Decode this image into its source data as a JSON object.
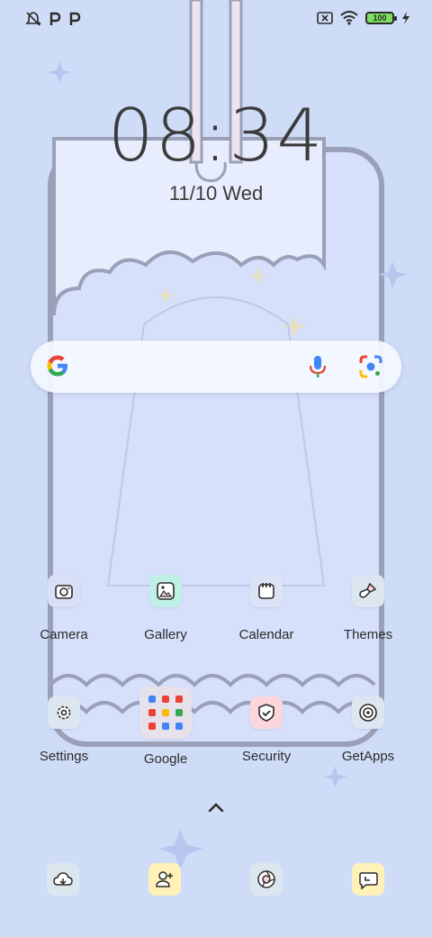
{
  "status_bar": {
    "left_icons": [
      "notifications-off-icon",
      "p-app-icon",
      "p-app-icon"
    ],
    "right_icons": [
      "sim-error-icon",
      "wifi-icon",
      "battery-icon",
      "charging-icon"
    ],
    "battery_level": "100"
  },
  "clock": {
    "time": "08:34",
    "date": "11/10 Wed"
  },
  "search": {
    "logo": "google-g-icon",
    "voice_icon": "microphone-icon",
    "lens_icon": "google-lens-icon"
  },
  "apps_row1": [
    {
      "label": "Camera",
      "icon": "camera-icon",
      "color": "#d9e0f5"
    },
    {
      "label": "Gallery",
      "icon": "gallery-icon",
      "color": "#bff0e6"
    },
    {
      "label": "Calendar",
      "icon": "calendar-icon",
      "color": "#dde3f7"
    },
    {
      "label": "Themes",
      "icon": "brush-icon",
      "color": "#dbe6ef"
    }
  ],
  "apps_row2": [
    {
      "label": "Settings",
      "icon": "gear-icon",
      "color": "#dbe6ef"
    },
    {
      "label": "Google",
      "icon": "folder-icon",
      "color": "#e6e1ea"
    },
    {
      "label": "Security",
      "icon": "shield-check-icon",
      "color": "#fbd6dd"
    },
    {
      "label": "GetApps",
      "icon": "getapps-icon",
      "color": "#dbe6ef"
    }
  ],
  "app_drawer_icon": "chevron-up-icon",
  "dock": [
    {
      "icon": "cloud-app-icon",
      "color": "#dbe6ef"
    },
    {
      "icon": "add-contact-icon",
      "color": "#fff1b8"
    },
    {
      "icon": "browser-icon",
      "color": "#dbe6ef"
    },
    {
      "icon": "messaging-icon",
      "color": "#fff1b8"
    }
  ]
}
